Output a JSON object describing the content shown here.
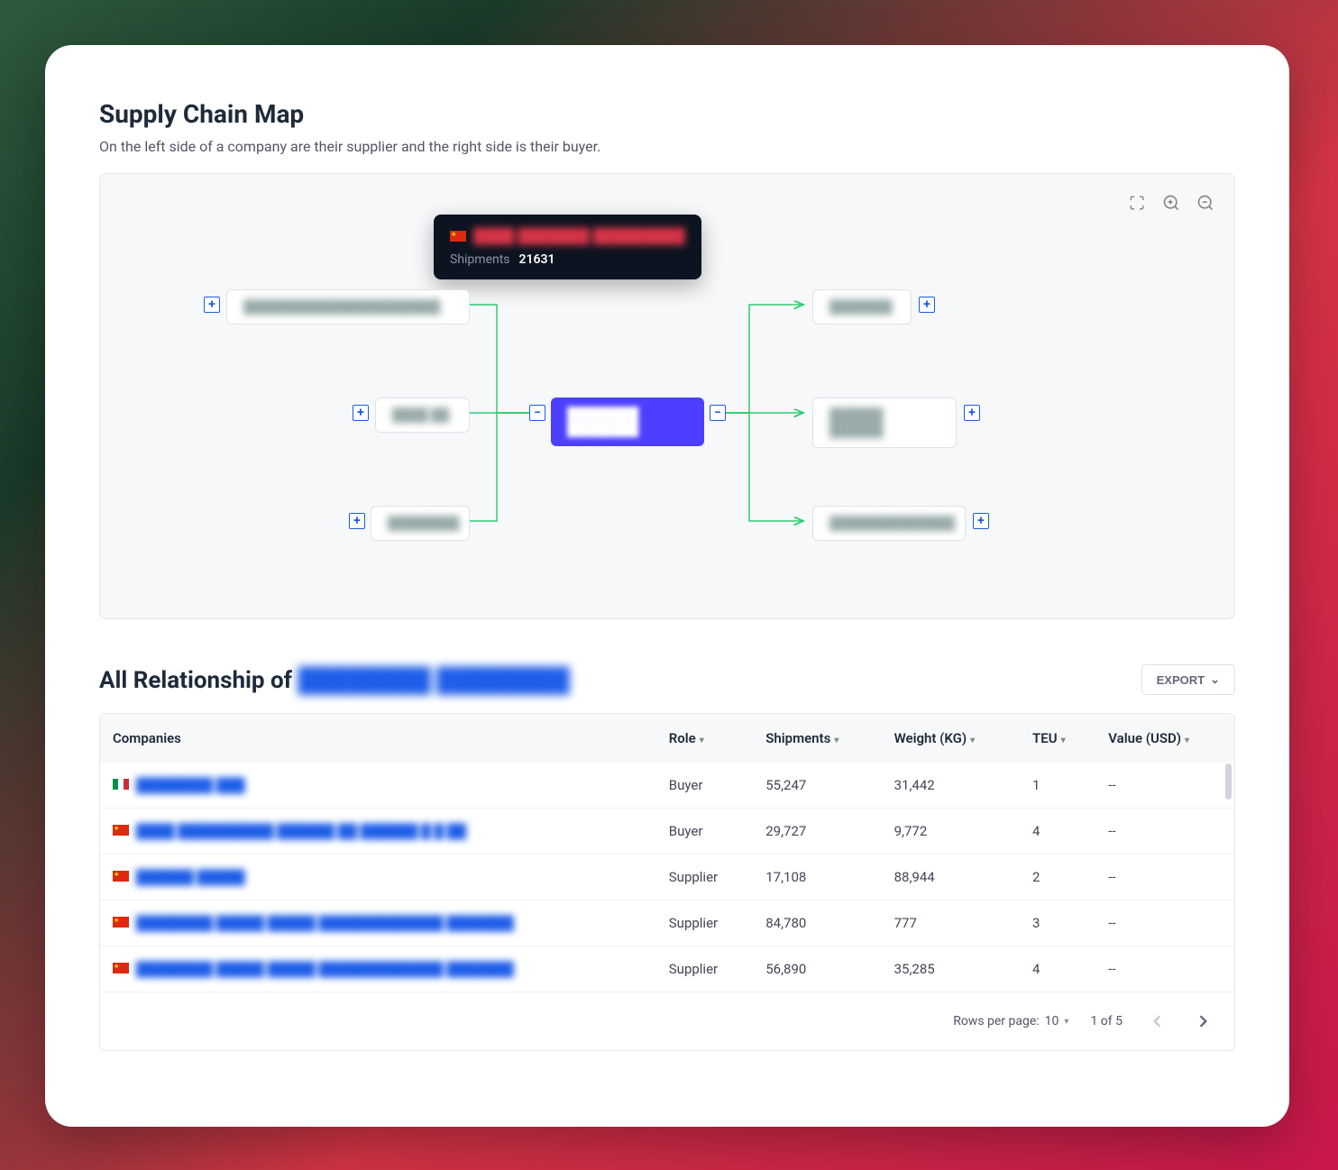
{
  "header": {
    "title": "Supply Chain Map",
    "subtitle": "On the left side of a company are their supplier and the right side is their buyer."
  },
  "tooltip": {
    "company": "████ ███████ █████████",
    "label": "Shipments",
    "value": "21631"
  },
  "map": {
    "suppliers": [
      {
        "name": "██████████████████████"
      },
      {
        "name": "████ ██"
      },
      {
        "name": "████████"
      }
    ],
    "center": {
      "name": "████████ ████████"
    },
    "buyers": [
      {
        "name": "███████"
      },
      {
        "name": "██████ ██████"
      },
      {
        "name": "██████████████"
      }
    ]
  },
  "relationship": {
    "title_prefix": "All Relationship of",
    "title_name": "████████ ████████",
    "export_label": "EXPORT"
  },
  "table": {
    "headers": {
      "companies": "Companies",
      "role": "Role",
      "shipments": "Shipments",
      "weight": "Weight (KG)",
      "teu": "TEU",
      "value": "Value (USD)"
    },
    "rows": [
      {
        "flag": "it",
        "company": "████████ ███",
        "role": "Buyer",
        "shipments": "55,247",
        "weight": "31,442",
        "teu": "1",
        "value": "--"
      },
      {
        "flag": "cn",
        "company": "████ ██████████ ██████ ██ ██████ █ █ ██",
        "role": "Buyer",
        "shipments": "29,727",
        "weight": "9,772",
        "teu": "4",
        "value": "--"
      },
      {
        "flag": "cn",
        "company": "██████ █████",
        "role": "Supplier",
        "shipments": "17,108",
        "weight": "88,944",
        "teu": "2",
        "value": "--"
      },
      {
        "flag": "cn",
        "company": "████████ █████ █████ █████████████ ███████",
        "role": "Supplier",
        "shipments": "84,780",
        "weight": "777",
        "teu": "3",
        "value": "--"
      },
      {
        "flag": "cn",
        "company": "████████ █████ █████ █████████████ ███████",
        "role": "Supplier",
        "shipments": "56,890",
        "weight": "35,285",
        "teu": "4",
        "value": "--"
      }
    ]
  },
  "pagination": {
    "rows_label": "Rows per page:",
    "rows_value": "10",
    "page_info": "1 of 5"
  }
}
